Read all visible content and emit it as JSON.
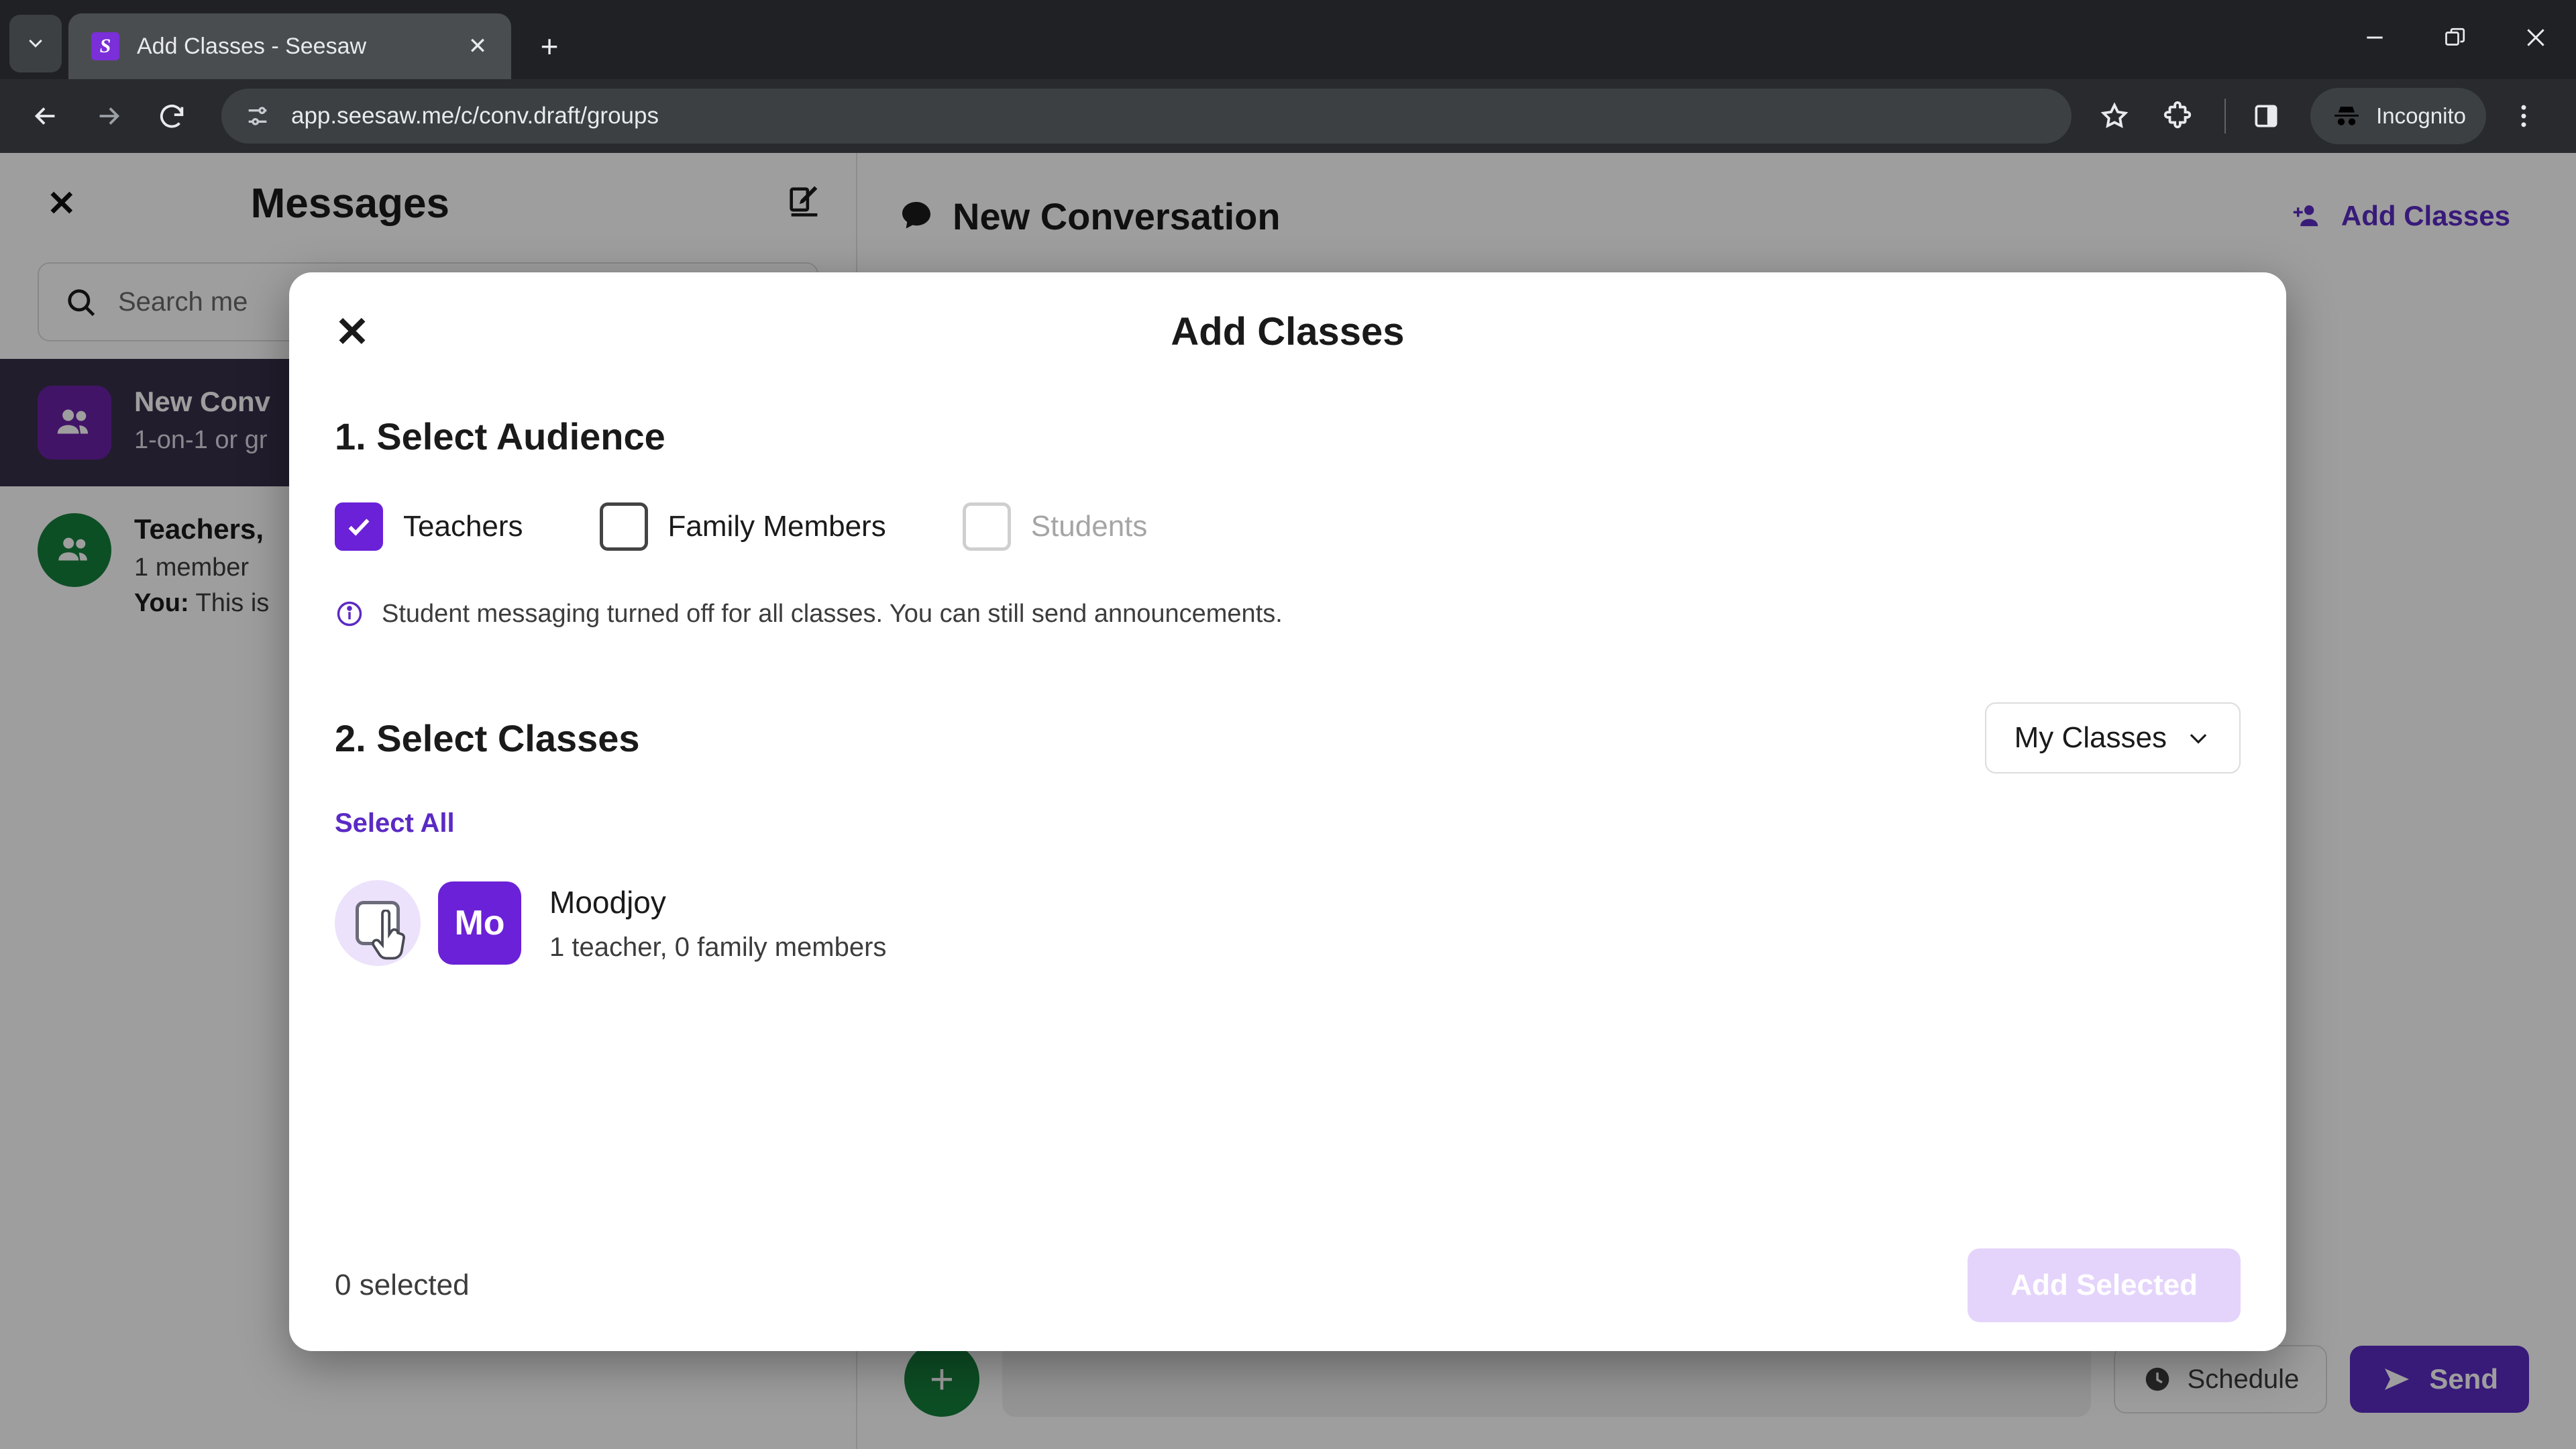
{
  "browser": {
    "tab": {
      "title": "Add Classes - Seesaw",
      "favicon_letter": "S"
    },
    "new_tab_label": "+",
    "tab_close_label": "✕",
    "window": {
      "minimize": "—",
      "maximize": "❐",
      "close": "✕"
    },
    "omnibox": {
      "url": "app.seesaw.me/c/conv.draft/groups"
    },
    "incognito_label": "Incognito"
  },
  "sidebar": {
    "close_label": "✕",
    "title": "Messages",
    "search_placeholder": "Search me",
    "conversations": [
      {
        "name": "New Conv",
        "subtitle": "1-on-1 or gr",
        "snippet": "",
        "snippet_prefix": "",
        "avatar_color": "#6b21a8",
        "active": true
      },
      {
        "name": "Teachers,",
        "subtitle": "1 member",
        "snippet": "This is",
        "snippet_prefix": "You:",
        "avatar_color": "#15803d",
        "active": false
      }
    ]
  },
  "main": {
    "title": "New Conversation",
    "subtitle": "",
    "add_classes_label": "Add Classes",
    "add_button_label": "+",
    "schedule_label": "Schedule",
    "send_label": "Send"
  },
  "modal": {
    "close_label": "✕",
    "title": "Add Classes",
    "step1_title": "1. Select Audience",
    "audience": [
      {
        "label": "Teachers",
        "state": "checked"
      },
      {
        "label": "Family Members",
        "state": "unchecked"
      },
      {
        "label": "Students",
        "state": "disabled"
      }
    ],
    "note": "Student messaging turned off for all classes. You can still send announcements.",
    "step2_title": "2. Select Classes",
    "dropdown_value": "My Classes",
    "select_all_label": "Select All",
    "classes": [
      {
        "name": "Moodjoy",
        "meta": "1 teacher, 0 family members",
        "initials": "Mo",
        "checked": false
      }
    ],
    "selected_count": "0 selected",
    "add_selected_label": "Add Selected"
  },
  "colors": {
    "brand_purple": "#5b2ac4",
    "checkbox_purple": "#6b21d8",
    "avatar_purple": "#6b21d8",
    "green": "#15803d",
    "disabled_purple": "#e4d4fb"
  }
}
